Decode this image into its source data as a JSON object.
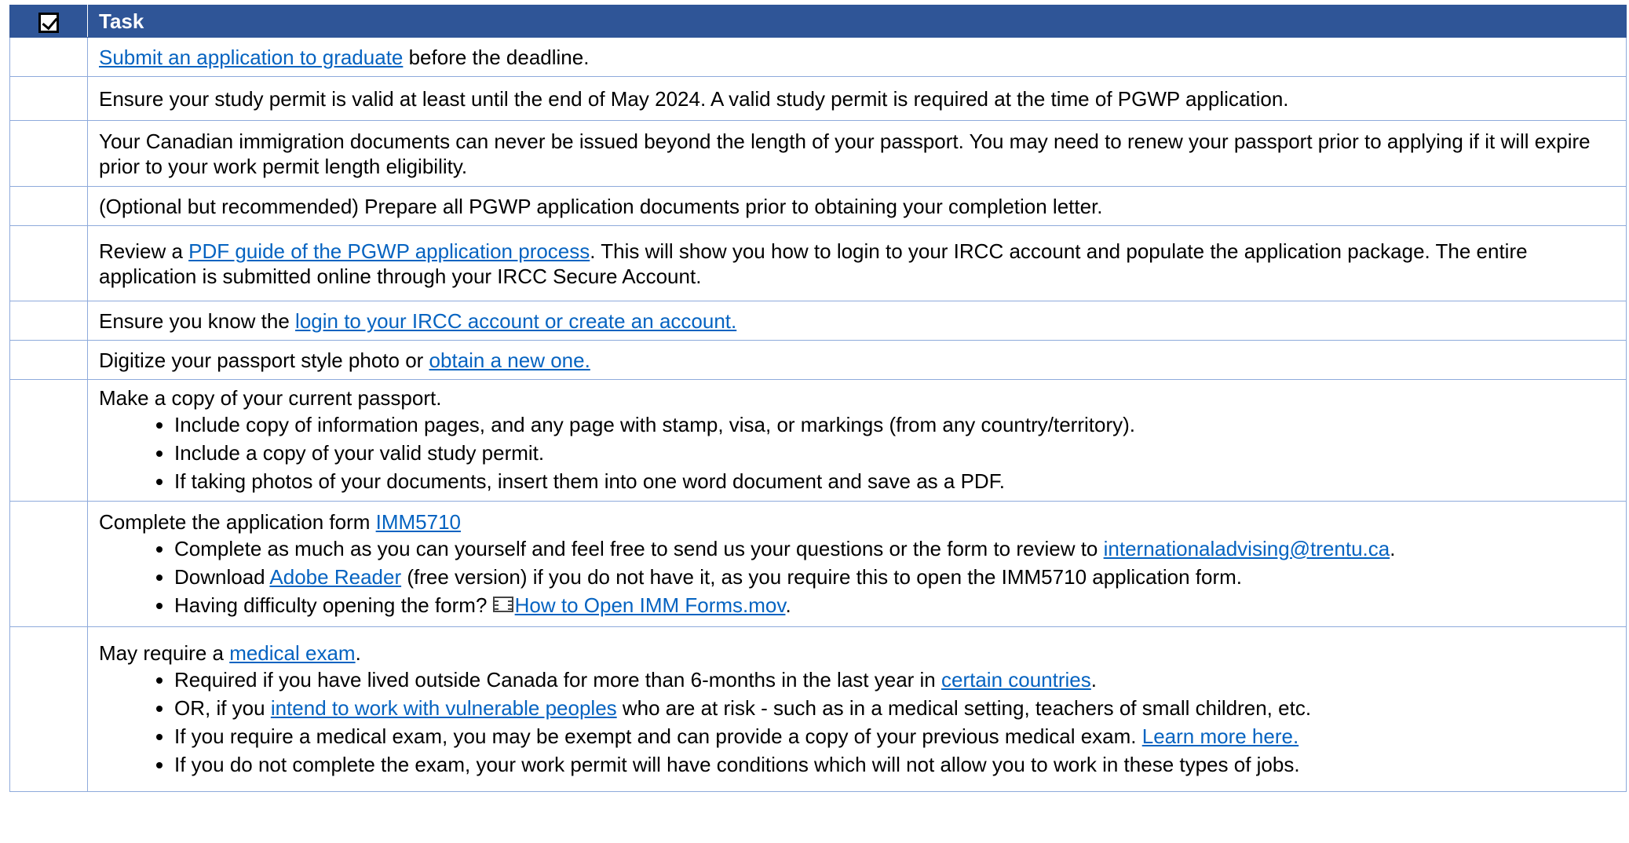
{
  "header": {
    "task_label": "Task"
  },
  "rows": [
    {
      "link": "Submit an application to graduate",
      "after": " before the deadline."
    },
    {
      "text": "Ensure your study permit is valid at least until the end of May 2024. A valid study permit is required at the time of PGWP application."
    },
    {
      "text": "Your Canadian immigration documents can never be issued beyond the length of your passport. You may need to renew your passport prior to applying if it will expire prior to your work permit length eligibility."
    },
    {
      "text": "(Optional but recommended) Prepare all PGWP application documents prior to obtaining your completion letter."
    },
    {
      "before": "Review a ",
      "link": "PDF guide of the PGWP application process",
      "after": ". This will show you how to login to your IRCC account and populate the application package. The entire application is submitted online through your IRCC Secure Account."
    },
    {
      "before": "Ensure you know the ",
      "link": "login to your IRCC account or create an account."
    },
    {
      "before": "Digitize your passport style photo or ",
      "link": "obtain a new one."
    },
    {
      "text": "Make a copy of your current passport.",
      "bullets": [
        "Include copy of information pages, and any page with stamp, visa, or markings (from any country/territory).",
        "Include a copy of your valid study permit.",
        "If taking photos of your documents, insert them into one word document and save as a PDF."
      ]
    },
    {
      "before": "Complete the application form ",
      "link": "IMM5710",
      "bullets": [
        {
          "before": "Complete as much as you can yourself and feel free to send us your questions or the form to review to ",
          "link": "internationaladvising@trentu.ca",
          "after": "."
        },
        {
          "before": "Download ",
          "link": "Adobe Reader",
          "after": " (free version) if you do not have it, as you require this to open the IMM5710 application form."
        },
        {
          "before": "Having difficulty opening the form? ",
          "link": "How to Open IMM Forms.mov",
          "after": "."
        }
      ]
    },
    {
      "before": "May require a ",
      "link": "medical exam",
      "after": ".",
      "bullets": [
        {
          "before": "Required if you have lived outside Canada for more than 6-months in the last year in ",
          "link": "certain countries",
          "after": "."
        },
        {
          "before": "OR, if you ",
          "link": "intend to work with vulnerable peoples",
          "after": " who are at risk - such as in a medical setting, teachers of small children, etc."
        },
        {
          "before": "If you require a medical exam, you may be exempt and can provide a copy of your previous medical exam. ",
          "link": "Learn more here."
        },
        {
          "before": "If you do not complete the exam, your work permit will have conditions which will not allow you to work in these types of jobs."
        }
      ]
    }
  ],
  "icons": {
    "header_checkbox": "checked-box-icon",
    "video_file": "film-strip-icon"
  },
  "colors": {
    "header_bg": "#2f5597",
    "link": "#0563c1",
    "border": "#8eaadb"
  }
}
